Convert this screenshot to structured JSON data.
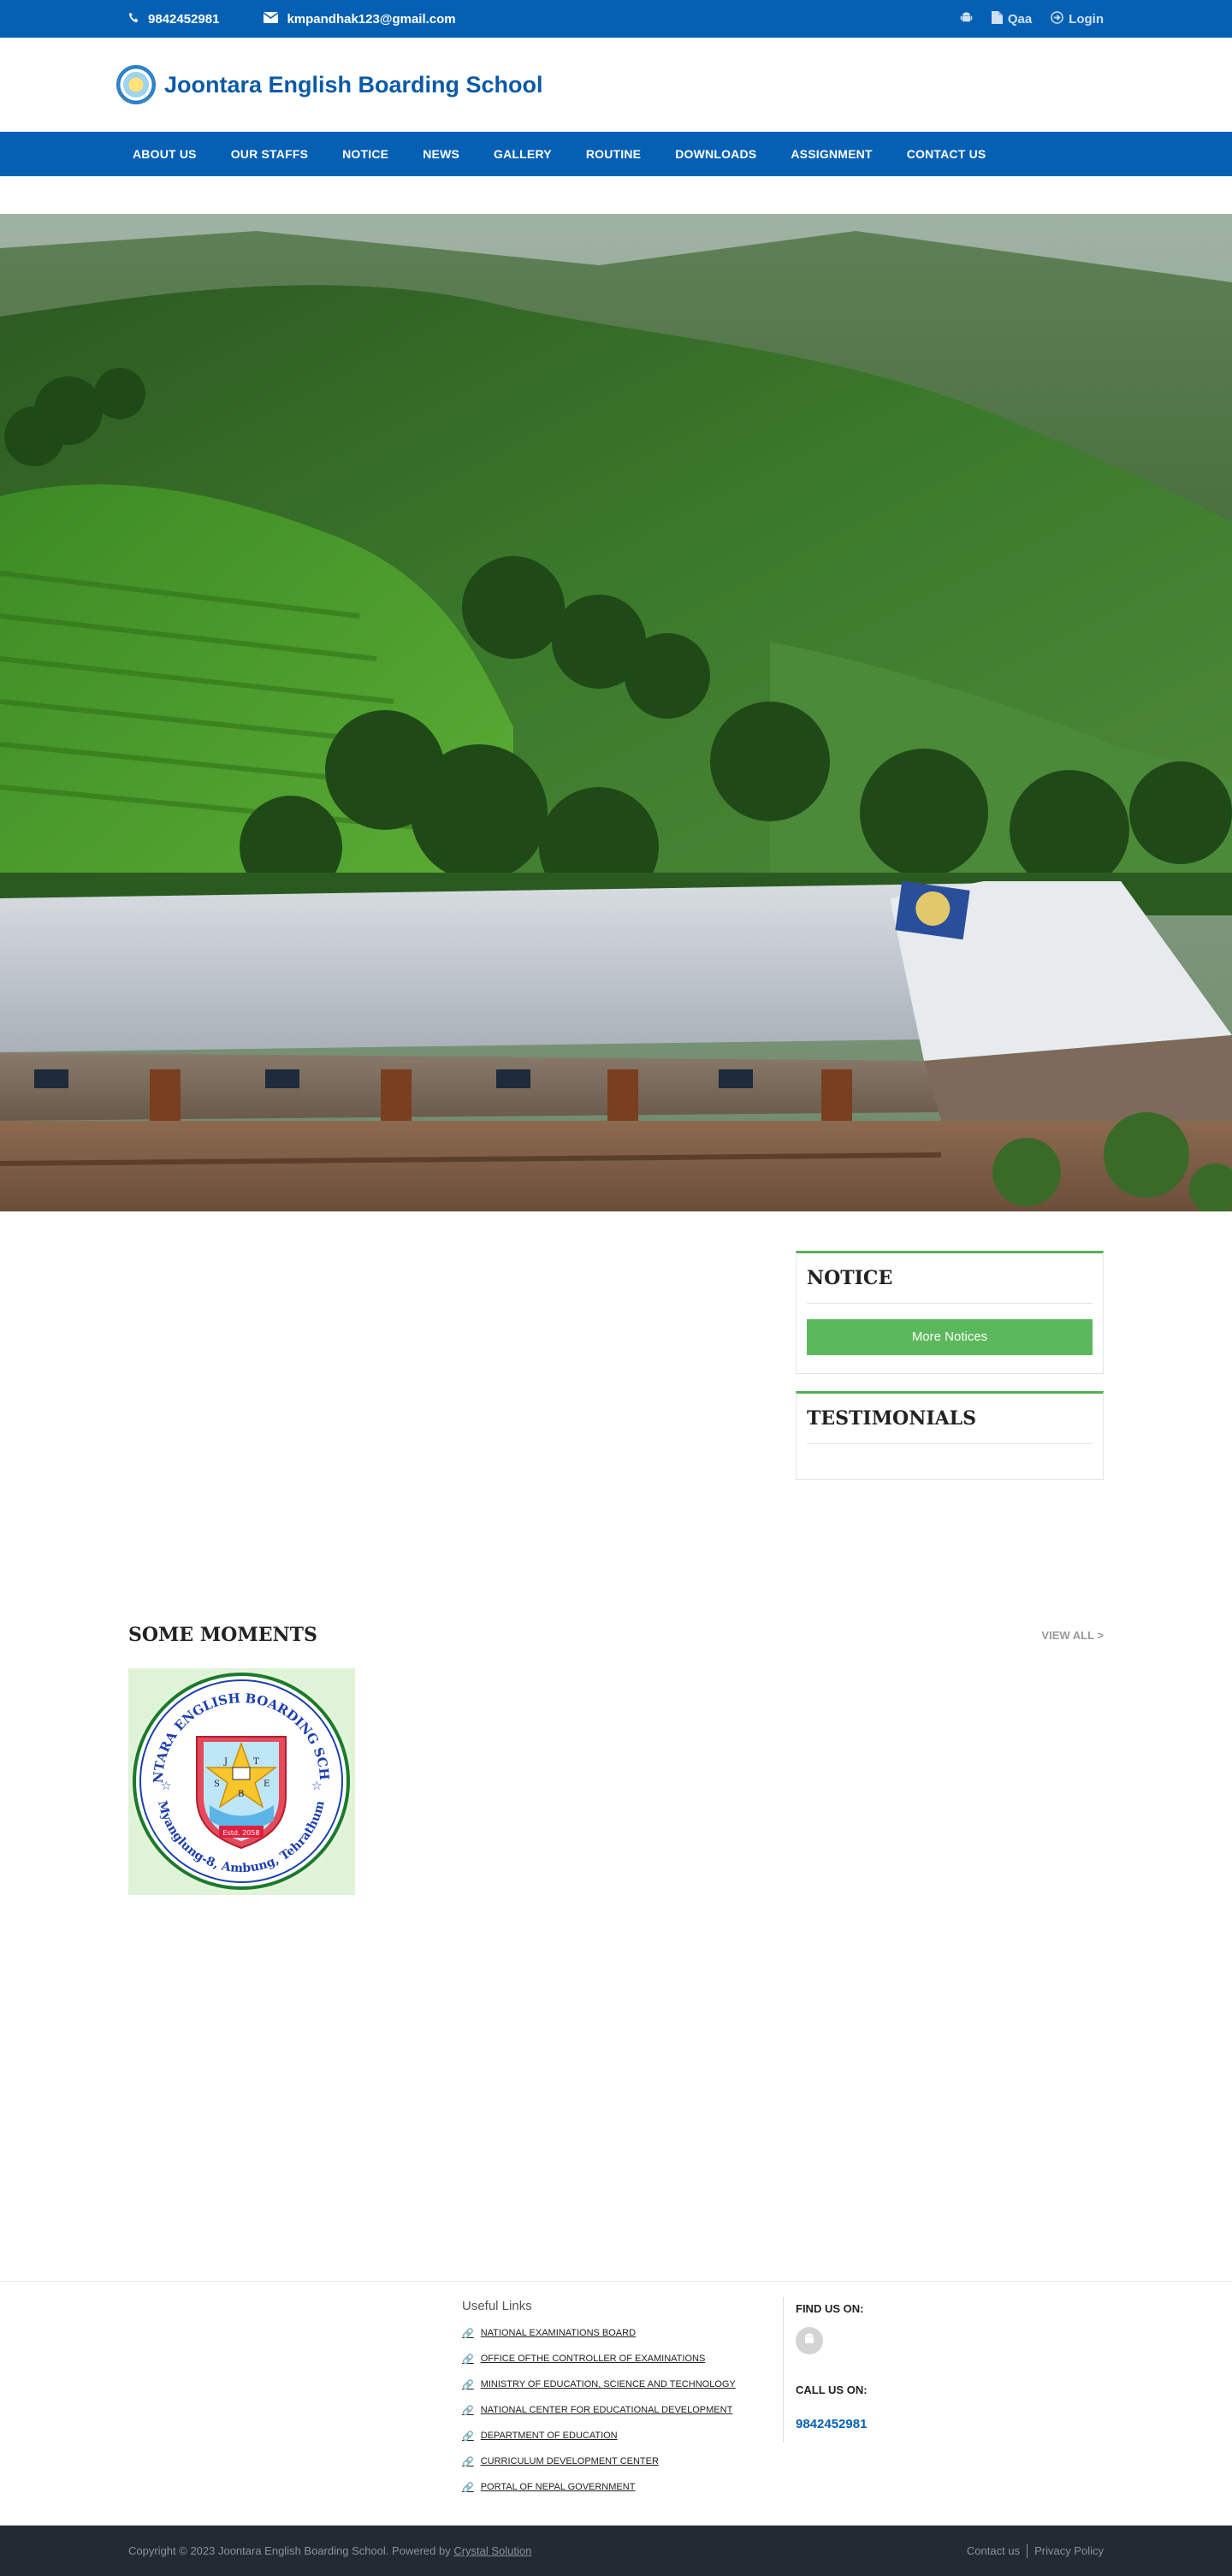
{
  "topbar": {
    "phone": "9842452981",
    "email": "kmpandhak123@gmail.com",
    "qaa": "Qaa",
    "login": "Login"
  },
  "header": {
    "school_name": "Joontara English Boarding School"
  },
  "nav": {
    "items": [
      "ABOUT US",
      "OUR STAFFS",
      "NOTICE",
      "NEWS",
      "GALLERY",
      "ROUTINE",
      "DOWNLOADS",
      "ASSIGNMENT",
      "CONTACT US"
    ]
  },
  "sidebar": {
    "notice_title": "NOTICE",
    "more_notices": "More Notices",
    "testimonials_title": "TESTIMONIALS"
  },
  "moments": {
    "title": "SOME MOMENTS",
    "view_all": "VIEW ALL >",
    "logo_text_top": "JOONTARA ENGLISH BOARDING SCHOOL",
    "logo_text_bottom": "Myanglung-8, Ambung, Tehrathum",
    "logo_letters": [
      "J",
      "T",
      "S",
      "E",
      "B"
    ],
    "logo_estd": "Estd. 2058"
  },
  "footer": {
    "useful_links_title": "Useful Links",
    "useful_links": [
      "NATIONAL EXAMINATIONS BOARD",
      "OFFICE OFTHE CONTROLLER OF EXAMINATIONS",
      "MINISTRY OF EDUCATION, SCIENCE AND TECHNOLOGY",
      "NATIONAL CENTER FOR EDUCATIONAL DEVELOPMENT",
      "DEPARTMENT OF EDUCATION",
      "CURRICULUM DEVELOPMENT CENTER",
      "PORTAL OF NEPAL GOVERNMENT"
    ],
    "find_us": "FIND US ON:",
    "call_us": "CALL US ON:",
    "phone": "9842452981",
    "copyright": "Copyright © 2023 Joontara English Boarding School. Powered by ",
    "powered_by": "Crystal Solution",
    "contact_us": "Contact us",
    "privacy": "Privacy Policy"
  },
  "colors": {
    "brand_blue": "#0560b4",
    "accent_green": "#5cb85c",
    "footer_dark": "#242a33"
  },
  "icons": {
    "phone": "phone-icon",
    "email": "envelope-icon",
    "android": "android-icon",
    "document": "document-icon",
    "login": "login-icon",
    "link": "link-icon"
  }
}
